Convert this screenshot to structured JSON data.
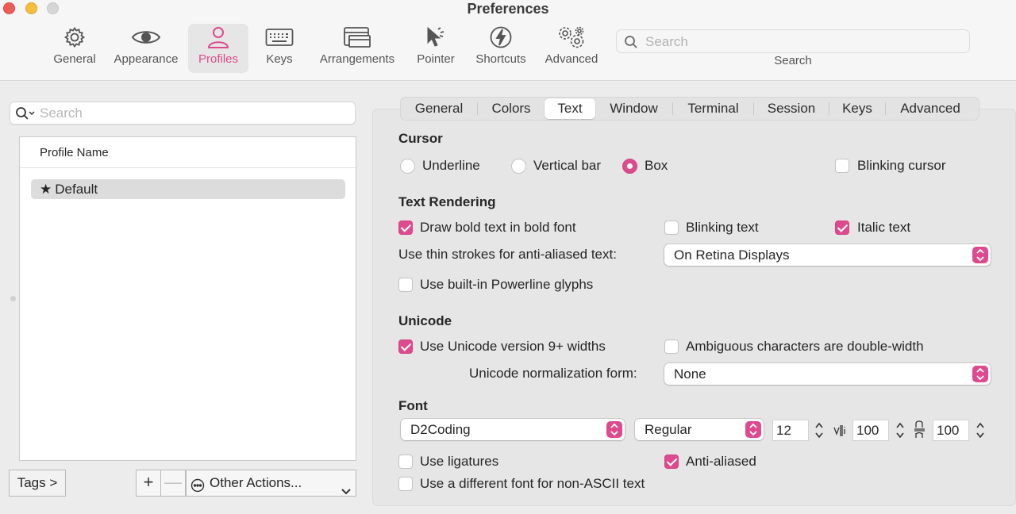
{
  "window": {
    "title": "Preferences"
  },
  "toolbar": {
    "items": [
      {
        "label": "General",
        "icon": "gear-icon"
      },
      {
        "label": "Appearance",
        "icon": "eye-icon"
      },
      {
        "label": "Profiles",
        "icon": "person-icon",
        "active": true
      },
      {
        "label": "Keys",
        "icon": "keyboard-icon"
      },
      {
        "label": "Arrangements",
        "icon": "windows-icon"
      },
      {
        "label": "Pointer",
        "icon": "pointer-icon"
      },
      {
        "label": "Shortcuts",
        "icon": "bolt-icon"
      },
      {
        "label": "Advanced",
        "icon": "gears-icon"
      }
    ],
    "search": {
      "placeholder": "Search",
      "label": "Search"
    }
  },
  "profiles": {
    "search_placeholder": "Search",
    "column_header": "Profile Name",
    "rows": [
      {
        "name": "Default",
        "icon": "star-icon"
      }
    ],
    "tags_button": "Tags >",
    "add_button": "+",
    "remove_button": "—",
    "other_actions": "Other Actions..."
  },
  "tabs": [
    "General",
    "Colors",
    "Text",
    "Window",
    "Terminal",
    "Session",
    "Keys",
    "Advanced"
  ],
  "active_tab": "Text",
  "cursor": {
    "title": "Cursor",
    "options": [
      "Underline",
      "Vertical bar",
      "Box"
    ],
    "selected": "Box",
    "blinking_label": "Blinking cursor",
    "blinking": false
  },
  "text_rendering": {
    "title": "Text Rendering",
    "bold_label": "Draw bold text in bold font",
    "bold": true,
    "blinking_text_label": "Blinking text",
    "blinking_text": false,
    "italic_label": "Italic text",
    "italic": true,
    "thin_strokes_label": "Use thin strokes for anti-aliased text:",
    "thin_strokes_value": "On Retina Displays",
    "powerline_label": "Use built-in Powerline glyphs",
    "powerline": false
  },
  "unicode": {
    "title": "Unicode",
    "version_label": "Use Unicode version 9+ widths",
    "version": true,
    "ambiguous_label": "Ambiguous characters are double-width",
    "ambiguous": false,
    "normalization_label": "Unicode normalization form:",
    "normalization_value": "None"
  },
  "font": {
    "title": "Font",
    "family": "D2Coding",
    "style": "Regular",
    "size": "12",
    "h_spacing": "100",
    "v_spacing": "100",
    "ligatures_label": "Use ligatures",
    "ligatures": false,
    "antialiased_label": "Anti-aliased",
    "antialiased": true,
    "non_ascii_label": "Use a different font for non-ASCII text",
    "non_ascii": false
  },
  "colors": {
    "accent": "#dd4b8e"
  }
}
